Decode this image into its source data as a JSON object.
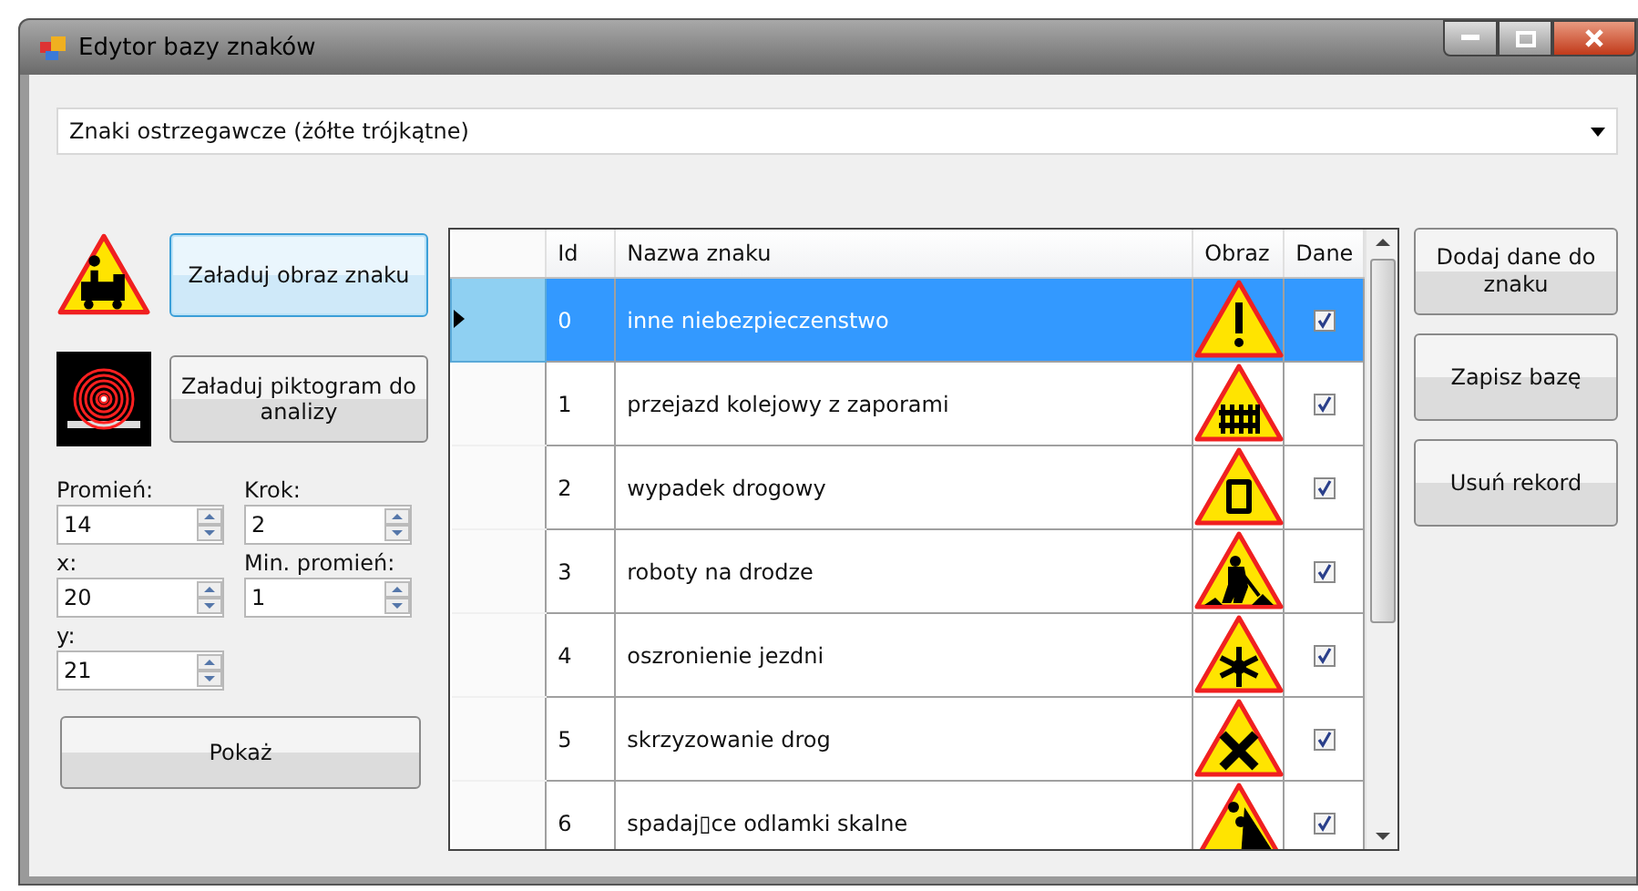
{
  "window": {
    "title": "Edytor bazy znaków"
  },
  "category": {
    "value": "Znaki ostrzegawcze (żółte trójkątne)"
  },
  "left": {
    "load_image_button": "Załaduj obraz znaku",
    "load_pictogram_button": "Załaduj piktogram do analizy",
    "show_button": "Pokaż",
    "fields": [
      {
        "label": "Promień:",
        "value": "14"
      },
      {
        "label": "Krok:",
        "value": "2"
      },
      {
        "label": "x:",
        "value": "20"
      },
      {
        "label": "Min. promień:",
        "value": "1"
      },
      {
        "label": "y:",
        "value": "21"
      }
    ]
  },
  "table": {
    "columns": [
      "Id",
      "Nazwa znaku",
      "Obraz",
      "Dane"
    ],
    "rows": [
      {
        "id": "0",
        "name": "inne niebezpieczenstwo",
        "dane": true,
        "selected": true
      },
      {
        "id": "1",
        "name": "przejazd kolejowy z zaporami",
        "dane": true,
        "selected": false
      },
      {
        "id": "2",
        "name": "wypadek drogowy",
        "dane": true,
        "selected": false
      },
      {
        "id": "3",
        "name": "roboty na drodze",
        "dane": true,
        "selected": false
      },
      {
        "id": "4",
        "name": "oszronienie jezdni",
        "dane": true,
        "selected": false
      },
      {
        "id": "5",
        "name": "skrzyzowanie drog",
        "dane": true,
        "selected": false
      },
      {
        "id": "6",
        "name": "spadaj▯ce odlamki skalne",
        "dane": true,
        "selected": false
      }
    ]
  },
  "right_buttons": [
    "Dodaj dane do znaku",
    "Zapisz bazę",
    "Usuń rekord"
  ]
}
